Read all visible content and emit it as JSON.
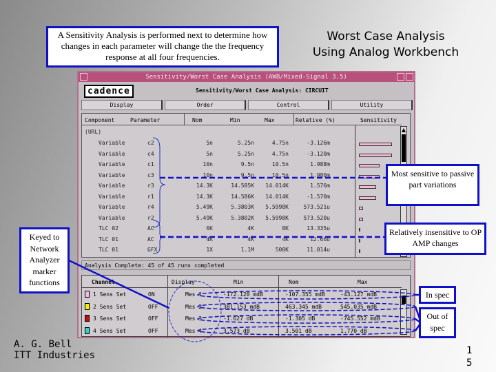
{
  "slide": {
    "intro_text": "A Sensitivity Analysis is performed next to determine how changes in each parameter will change the the frequency response at all four frequencies.",
    "title_line1": "Worst Case Analysis",
    "title_line2": "Using Analog Workbench",
    "callout_most_sensitive": "Most sensitive to passive part variations",
    "callout_insensitive": "Relatively insensitive to OP AMP changes",
    "callout_keyed": "Keyed to Network Analyzer marker functions",
    "callout_in_spec": "In spec",
    "callout_out_of_spec": "Out of spec",
    "author_line1": "A. G. Bell",
    "author_line2": "ITT Industries",
    "page_number": "1 5",
    "accent_color": "#1010c8"
  },
  "window": {
    "title": "Sensitivity/Worst Case Analysis (AWB/Mixed-Signal 3.5)",
    "logo": "cadence",
    "subtitle": "Sensitivity/Worst Case Analysis: CIRCUIT",
    "menu": [
      "Display",
      "Order",
      "Control",
      "Utility"
    ],
    "columns": [
      "Component",
      "Parameter",
      "Nom",
      "Min",
      "Max",
      "Relative (%)",
      "Sensitivity"
    ],
    "group": "(URL)",
    "rows": [
      {
        "component": "Variable",
        "parameter": "c2",
        "nom": "5n",
        "min": "5.25n",
        "max": "4.75n",
        "relative": "-3.126m",
        "sens": 0.95
      },
      {
        "component": "Variable",
        "parameter": "c4",
        "nom": "5n",
        "min": "5.25n",
        "max": "4.75n",
        "relative": "-3.120m",
        "sens": 0.95
      },
      {
        "component": "Variable",
        "parameter": "c1",
        "nom": "10n",
        "min": "9.5n",
        "max": "10.5n",
        "relative": "1.988m",
        "sens": 0.6
      },
      {
        "component": "Variable",
        "parameter": "c3",
        "nom": "10n",
        "min": "9.5n",
        "max": "10.5n",
        "relative": "1.980m",
        "sens": 0.6
      },
      {
        "component": "Variable",
        "parameter": "r3",
        "nom": "14.3K",
        "min": "14.585K",
        "max": "14.014K",
        "relative": "1.576m",
        "sens": 0.5
      },
      {
        "component": "Variable",
        "parameter": "r1",
        "nom": "14.3K",
        "min": "14.586K",
        "max": "14.014K",
        "relative": "-1.570m",
        "sens": 0.5
      },
      {
        "component": "Variable",
        "parameter": "r4",
        "nom": "5.49K",
        "min": "5.3803K",
        "max": "5.5998K",
        "relative": "573.521u",
        "sens": 0.12
      },
      {
        "component": "Variable",
        "parameter": "r2",
        "nom": "5.49K",
        "min": "5.3802K",
        "max": "5.5998K",
        "relative": "573.520u",
        "sens": 0.12
      },
      {
        "component": "TLC 02",
        "parameter": "AC",
        "nom": "6K",
        "min": "4K",
        "max": "8K",
        "relative": "13.335u",
        "sens": 0.01
      },
      {
        "component": "TLC 01",
        "parameter": "AC",
        "nom": "4K",
        "min": "4K",
        "max": "4K",
        "relative": "12.66u",
        "sens": 0.01
      },
      {
        "component": "TLC 01",
        "parameter": "GFX",
        "nom": "1X",
        "min": "1.1M",
        "max": "500K",
        "relative": "11.014u",
        "sens": 0.01
      }
    ],
    "status": "Analysis Complete: 45 of 45 runs completed",
    "channel_columns": [
      "Channel",
      "Display",
      "Min",
      "Nom",
      "Max"
    ],
    "channels": [
      {
        "name": "1 Sens Set",
        "state": "ON",
        "color": "#f4b8e8",
        "display": "Mes 1",
        "min": "-172.120 mdB",
        "nom": "-107.355 mdB",
        "max": "-43.127 mdB"
      },
      {
        "name": "2 Sens Set",
        "state": "OFF",
        "color": "#f4f000",
        "display": "Mes 2",
        "min": "381.153 mdB",
        "nom": "463.345 mdB",
        "max": "545.035 mdB"
      },
      {
        "name": "3 Sens Set",
        "state": "OFF",
        "color": "#c01010",
        "display": "Mes 3",
        "min": "-1.627 dB",
        "nom": "-1.305 dB",
        "max": "-745.552 mdB"
      },
      {
        "name": "4 Sens Set",
        "state": "OFF",
        "color": "#30d0d0",
        "display": "Mes 4",
        "min": "3.573 dB",
        "nom": "3.501 dB",
        "max": "1.770 dB"
      }
    ]
  }
}
